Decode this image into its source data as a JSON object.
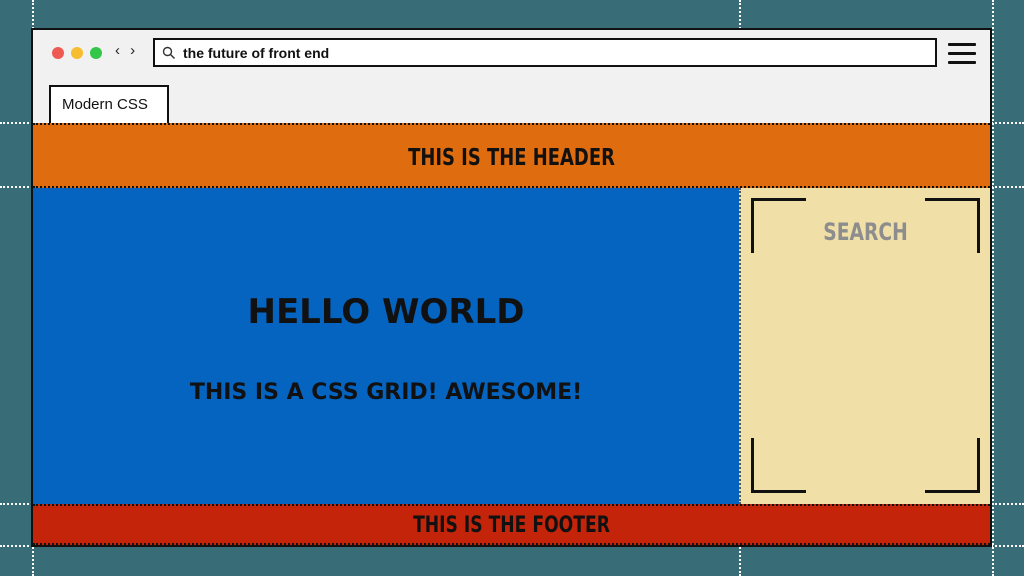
{
  "browser": {
    "url": "the future of front end",
    "tab_label": "Modern CSS",
    "nav_arrows": "‹ ›"
  },
  "page": {
    "header_text": "THIS IS THE HEADER",
    "main_heading": "HELLO WORLD",
    "main_subtext": "THIS IS A CSS GRID! AWESOME!",
    "sidebar_label": "SEARCH",
    "footer_text": "THIS IS THE FOOTER"
  },
  "colors": {
    "backdrop": "#386d78",
    "header": "#e06c10",
    "main": "#0464c0",
    "sidebar": "#f0e0a8",
    "footer": "#c4250a"
  },
  "icons": [
    "window-close-dot-icon",
    "window-minimize-dot-icon",
    "window-maximize-dot-icon",
    "nav-arrows-icon",
    "search-icon",
    "hamburger-menu-icon"
  ]
}
